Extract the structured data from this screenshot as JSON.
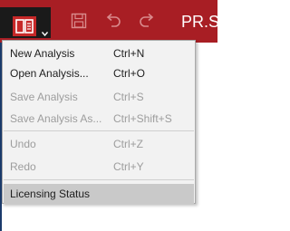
{
  "toolbar": {
    "title": "PR.St",
    "colors": {
      "accent": "#a81e24",
      "menu_bg": "#f2f2f2",
      "highlight": "#c9c9c9"
    },
    "icons": [
      "app-menu-icon",
      "chevron-down-icon",
      "save-icon",
      "undo-icon",
      "redo-icon"
    ]
  },
  "menu": {
    "items": [
      {
        "label": "New Analysis",
        "shortcut": "Ctrl+N",
        "enabled": true
      },
      {
        "label": "Open Analysis...",
        "shortcut": "Ctrl+O",
        "enabled": true
      },
      {
        "label": "Save Analysis",
        "shortcut": "Ctrl+S",
        "enabled": false
      },
      {
        "label": "Save Analysis As...",
        "shortcut": "Ctrl+Shift+S",
        "enabled": false
      },
      {
        "label": "Undo",
        "shortcut": "Ctrl+Z",
        "enabled": false
      },
      {
        "label": "Redo",
        "shortcut": "Ctrl+Y",
        "enabled": false
      },
      {
        "label": "Licensing Status",
        "shortcut": "",
        "enabled": true,
        "highlighted": true
      }
    ]
  }
}
